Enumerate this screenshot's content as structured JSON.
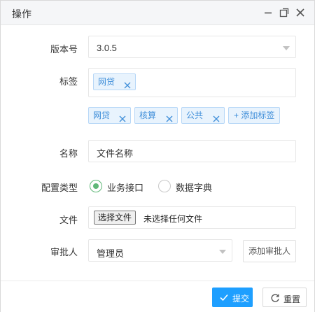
{
  "window": {
    "title": "操作"
  },
  "form": {
    "version": {
      "label": "版本号",
      "value": "3.0.5"
    },
    "tags": {
      "label": "标签",
      "selected": [
        "网贷"
      ],
      "options": [
        "网贷",
        "核算",
        "公共"
      ],
      "add_label": "+ 添加标签"
    },
    "name": {
      "label": "名称",
      "value": "文件名称"
    },
    "config_type": {
      "label": "配置类型",
      "options": [
        "业务接口",
        "数据字典"
      ],
      "selected": "业务接口"
    },
    "file": {
      "label": "文件",
      "button_label": "选择文件",
      "status": "未选择任何文件"
    },
    "approver": {
      "label": "审批人",
      "value": "管理员",
      "add_button_label": "添加审批人"
    }
  },
  "footer": {
    "submit_label": "提交",
    "reset_label": "重置"
  },
  "colors": {
    "accent": "#1e9fff",
    "radio_checked": "#5fb878",
    "tag_bg": "#e8f3fd",
    "tag_text": "#3f8ed9"
  }
}
